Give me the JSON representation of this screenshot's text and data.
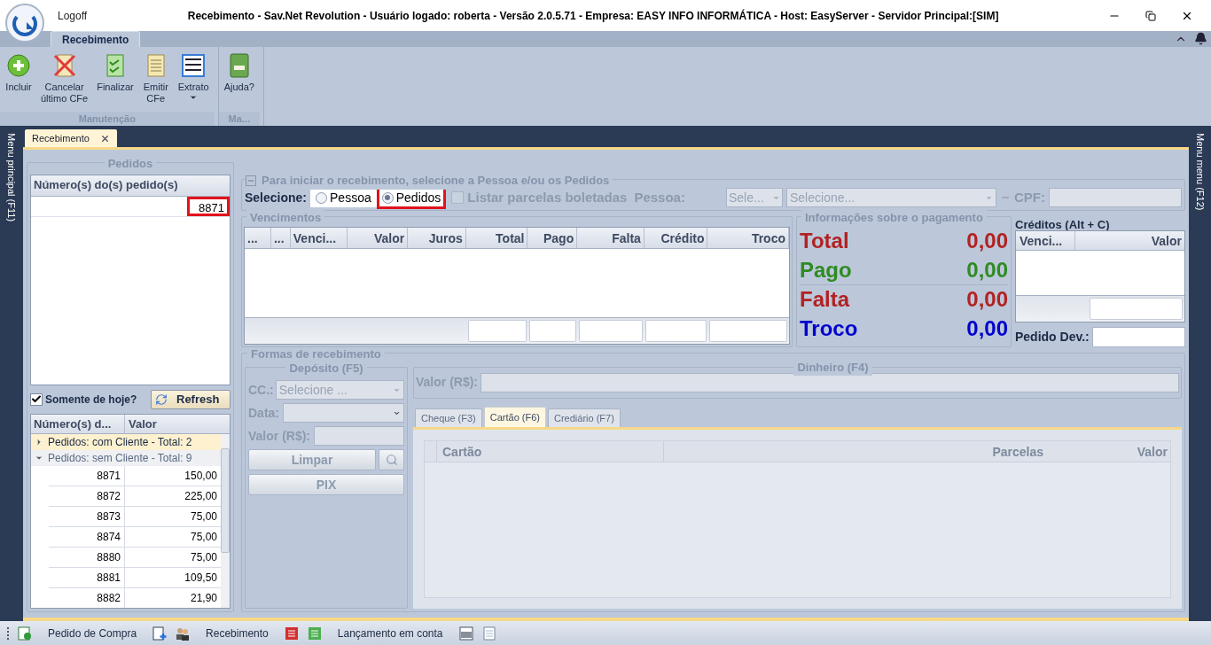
{
  "window": {
    "title": "Recebimento - Sav.Net Revolution - Usuário logado: roberta - Versão 2.0.5.71 - Empresa: EASY INFO INFORMÁTICA - Host: EasyServer - Servidor Principal:[SIM]",
    "logoff": "Logoff"
  },
  "ribbon": {
    "tabs": [
      {
        "label": "Recebimento",
        "selected": true
      }
    ],
    "groups": [
      {
        "label": "Manutenção",
        "buttons": [
          {
            "kind": "add",
            "label": "Incluir"
          },
          {
            "kind": "cancel",
            "label": "Cancelar\núltimo CFe"
          },
          {
            "kind": "finalize",
            "label": "Finalizar"
          },
          {
            "kind": "document",
            "label": "Emitir\nCFe"
          },
          {
            "kind": "statement",
            "label": "Extrato",
            "dropdown": true
          }
        ]
      },
      {
        "label": "Ma...",
        "buttons": [
          {
            "kind": "book",
            "label": "Ajuda?"
          }
        ]
      }
    ]
  },
  "side_menus": {
    "left": "Menu principal (F11)",
    "right": "Menu menu (F12)"
  },
  "document_tabs": [
    {
      "label": "Recebimento",
      "selected": true
    }
  ],
  "pedidos": {
    "title": "Pedidos",
    "column": "Número(s) do(s) pedido(s)",
    "entries": [
      {
        "value": "8871",
        "highlighted": true
      }
    ],
    "only_today": {
      "label": "Somente de hoje?",
      "checked": true
    },
    "refresh": "Refresh",
    "list": {
      "columns": [
        "Número(s) d...",
        "Valor"
      ],
      "groups": [
        {
          "label": "Pedidos: com Cliente - Total: 2",
          "expanded": false,
          "selected": true
        },
        {
          "label": "Pedidos: sem Cliente - Total: 9",
          "expanded": true,
          "selected": false,
          "rows": [
            {
              "number": "8871",
              "value": "150,00"
            },
            {
              "number": "8872",
              "value": "225,00"
            },
            {
              "number": "8873",
              "value": "75,00"
            },
            {
              "number": "8874",
              "value": "75,00"
            },
            {
              "number": "8880",
              "value": "75,00"
            },
            {
              "number": "8881",
              "value": "109,50"
            },
            {
              "number": "8882",
              "value": "21,90"
            }
          ]
        }
      ]
    }
  },
  "start": {
    "legend": "Para iniciar o recebimento, selecione a Pessoa e/ou os Pedidos",
    "select_label": "Selecione:",
    "radios": [
      {
        "label": "Pessoa",
        "selected": false,
        "highlighted": false
      },
      {
        "label": "Pedidos",
        "selected": true,
        "highlighted": true
      }
    ],
    "boleto": {
      "label": "Listar parcelas boletadas",
      "checked": false
    },
    "pessoa_label": "Pessoa:",
    "combo_short": "Sele...",
    "combo_long": "Selecione...",
    "cpf_label": "CPF:"
  },
  "vencimentos": {
    "title": "Vencimentos",
    "columns": [
      "...",
      "...",
      "Venci...",
      "Valor",
      "Juros",
      "Total",
      "Pago",
      "Falta",
      "Crédito",
      "Troco"
    ]
  },
  "payment_info": {
    "title": "Informações sobre o pagamento",
    "items": [
      {
        "label": "Total",
        "value": "0,00",
        "color": "#b22222"
      },
      {
        "label": "Pago",
        "value": "0,00",
        "color": "#2e8b22"
      },
      {
        "label": "Falta",
        "value": "0,00",
        "color": "#b22222"
      },
      {
        "label": "Troco",
        "value": "0,00",
        "color": "#0000cd"
      }
    ]
  },
  "creditos": {
    "title": "Créditos (Alt + C)",
    "columns": [
      "Venci...",
      "Valor"
    ],
    "pedido_dev_label": "Pedido Dev.:"
  },
  "formas": {
    "title": "Formas de recebimento",
    "deposito": {
      "title": "Depósito (F5)",
      "cc_label": "CC.:",
      "cc_placeholder": "Selecione ...",
      "data_label": "Data:",
      "valor_label": "Valor (R$):",
      "clear": "Limpar",
      "pix": "PIX"
    },
    "dinheiro": {
      "title": "Dinheiro (F4)",
      "valor_label": "Valor (R$):"
    },
    "tabs": [
      {
        "label": "Cheque (F3)",
        "selected": false
      },
      {
        "label": "Cartão (F6)",
        "selected": true
      },
      {
        "label": "Crediário (F7)",
        "selected": false
      }
    ],
    "card_columns": [
      "Cartão",
      "Parcelas",
      "Valor"
    ]
  },
  "status_bar": [
    {
      "kind": "doc-dollar",
      "label": "Pedido de Compra"
    },
    {
      "kind": "doc-plus"
    },
    {
      "kind": "people",
      "label": "Recebimento"
    },
    {
      "kind": "red-list"
    },
    {
      "kind": "green-list",
      "label": "Lançamento em conta"
    },
    {
      "kind": "barcode"
    },
    {
      "kind": "page"
    }
  ]
}
